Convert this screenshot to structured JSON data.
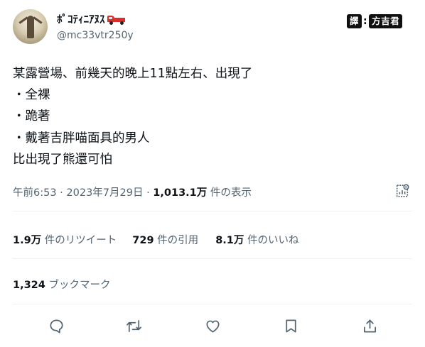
{
  "author": {
    "display_name": "ﾎﾟｺﾃｨﾆｱﾇｽ",
    "display_emoji": "pickup-truck",
    "handle": "@mc33vtr250y"
  },
  "translator_badge": {
    "label": "譯",
    "separator": ":",
    "name": "方吉君"
  },
  "tweet": {
    "lines": [
      "某露營場、前幾天的晚上11點左右、出現了",
      "・全裸",
      "・跪著",
      "・戴著吉胖喵面具的男人",
      "比出現了熊還可怕"
    ]
  },
  "meta": {
    "time": "午前6:53",
    "sep1": " · ",
    "date": "2023年7月29日",
    "sep2": " · ",
    "views_count": "1,013.1万",
    "views_label": " 件の表示"
  },
  "stats": {
    "retweets_count": "1.9万",
    "retweets_label": " 件のリツイート",
    "quotes_count": "729",
    "quotes_label": " 件の引用",
    "likes_count": "8.1万",
    "likes_label": " 件のいいね"
  },
  "bookmarks": {
    "count": "1,324",
    "label": " ブックマーク"
  },
  "colors": {
    "text": "#0f1419",
    "secondary": "#536471",
    "divider": "#eff3f4",
    "badge_bg": "#101010"
  }
}
